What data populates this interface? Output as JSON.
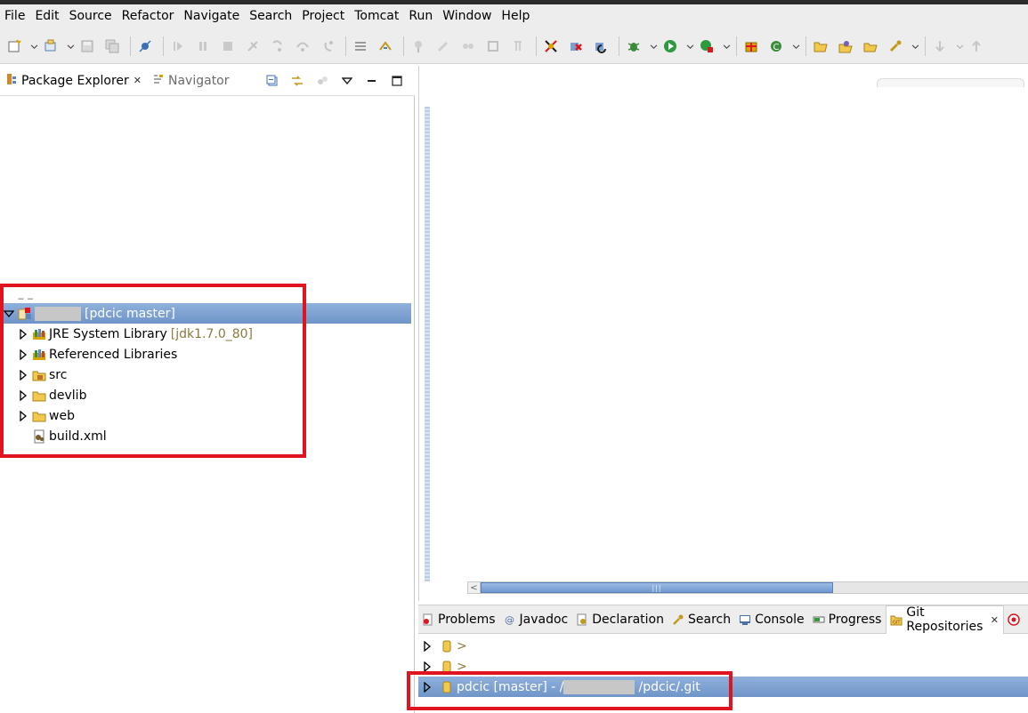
{
  "menu": [
    "File",
    "Edit",
    "Source",
    "Refactor",
    "Navigate",
    "Search",
    "Project",
    "Tomcat",
    "Run",
    "Window",
    "Help"
  ],
  "left_view": {
    "tabs": [
      {
        "label": "Package Explorer",
        "active": true,
        "close": "✕"
      },
      {
        "label": "Navigator",
        "active": false
      }
    ],
    "tree": {
      "project": {
        "label": "[pdcic master]",
        "redacted": true
      },
      "children": [
        {
          "label": "JRE System Library",
          "decoration": "[jdk1.7.0_80]",
          "icon": "library-icon",
          "expandable": true
        },
        {
          "label": "Referenced Libraries",
          "decoration": "",
          "icon": "library-icon",
          "expandable": true
        },
        {
          "label": "src",
          "decoration": "",
          "icon": "package-folder-icon",
          "expandable": true
        },
        {
          "label": "devlib",
          "decoration": "",
          "icon": "folder-icon",
          "expandable": true
        },
        {
          "label": "web",
          "decoration": "",
          "icon": "folder-icon",
          "expandable": true
        },
        {
          "label": "build.xml",
          "decoration": "",
          "icon": "ant-file-icon",
          "expandable": false
        }
      ]
    }
  },
  "bottom_view": {
    "tabs": [
      {
        "label": "Problems",
        "icon": "problems-icon"
      },
      {
        "label": "Javadoc",
        "icon": "at-icon"
      },
      {
        "label": "Declaration",
        "icon": "declaration-icon"
      },
      {
        "label": "Search",
        "icon": "search-icon"
      },
      {
        "label": "Console",
        "icon": "console-icon"
      },
      {
        "label": "Progress",
        "icon": "progress-icon"
      },
      {
        "label": "Git Repositories",
        "icon": "git-icon",
        "active": true,
        "close": "✕"
      }
    ],
    "repos": [
      {
        "label": ">",
        "selected": false
      },
      {
        "label": ">",
        "selected": false
      },
      {
        "label_before": "pdcic [master] - /",
        "label_after": "/pdcic/.git",
        "selected": true
      }
    ]
  },
  "editor": {
    "scroll_grip": "|||",
    "scroll_arrow": "<"
  },
  "colors": {
    "selection": "#7a9fd3",
    "highlight_box": "#e0141e",
    "decoration": "#8b7a3f"
  }
}
